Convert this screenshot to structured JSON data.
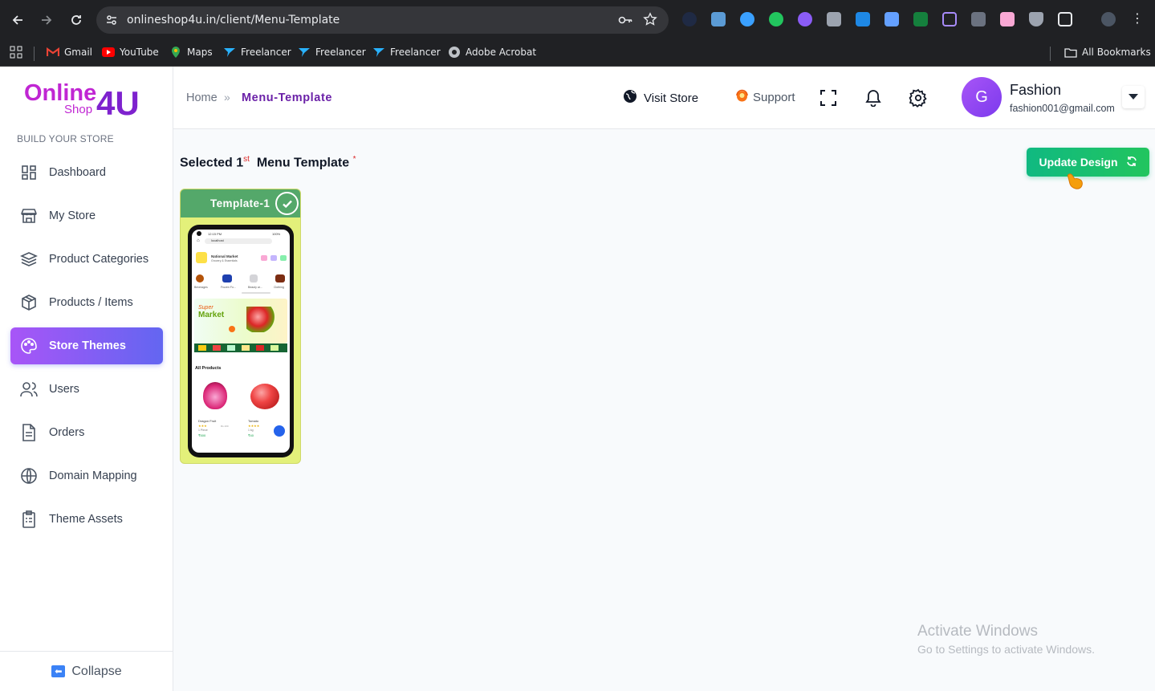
{
  "browser": {
    "url": "onlineshop4u.in/client/Menu-Template",
    "bookmarks": [
      {
        "label": "Gmail",
        "icon": "gmail-icon"
      },
      {
        "label": "YouTube",
        "icon": "youtube-icon"
      },
      {
        "label": "Maps",
        "icon": "maps-icon"
      },
      {
        "label": "Freelancer",
        "icon": "freelancer-icon"
      },
      {
        "label": "Freelancer",
        "icon": "freelancer-icon"
      },
      {
        "label": "Freelancer",
        "icon": "freelancer-icon"
      },
      {
        "label": "Adobe Acrobat",
        "icon": "acrobat-icon"
      }
    ],
    "all_bookmarks": "All Bookmarks"
  },
  "sidebar": {
    "section_label": "BUILD YOUR STORE",
    "logo": {
      "line1": "Online",
      "line2": "Shop",
      "mark": "4U"
    },
    "items": [
      {
        "label": "Dashboard",
        "icon": "dashboard-icon"
      },
      {
        "label": "My Store",
        "icon": "store-icon"
      },
      {
        "label": "Product Categories",
        "icon": "layers-icon"
      },
      {
        "label": "Products / Items",
        "icon": "box-icon"
      },
      {
        "label": "Store Themes",
        "icon": "palette-icon",
        "active": true
      },
      {
        "label": "Users",
        "icon": "users-icon"
      },
      {
        "label": "Orders",
        "icon": "document-icon"
      },
      {
        "label": "Domain Mapping",
        "icon": "globe-icon"
      },
      {
        "label": "Theme Assets",
        "icon": "clipboard-icon"
      }
    ],
    "collapse_label": "Collapse"
  },
  "header": {
    "breadcrumb_home": "Home",
    "breadcrumb_sep": "»",
    "breadcrumb_current": "Menu-Template",
    "visit_store": "Visit Store",
    "support": "Support",
    "user": {
      "initial": "G",
      "name": "Fashion",
      "email": "fashion001@gmail.com"
    }
  },
  "main": {
    "heading_prefix": "Selected 1",
    "heading_ordinal": "st",
    "heading_suffix": "Menu Template",
    "required_mark": "*",
    "update_button": "Update Design",
    "template": {
      "label": "Template-1",
      "preview": {
        "time": "12:15 PM",
        "battery": "100%",
        "search": "localhost",
        "brand": "National Market",
        "tagline": "Grocery & Essentials",
        "categories": [
          "Beverages",
          "Frozen Fo...",
          "Beauty ar...",
          "Clothing"
        ],
        "banner_script": "Super",
        "banner_title": "Market",
        "section_title": "All Products",
        "products": [
          {
            "name": "Dragon Fruit",
            "unit": "1 Piece",
            "price": "₹500",
            "mrp": "Rs.100"
          },
          {
            "name": "Tomato",
            "unit": "1 kg",
            "price": "₹40"
          }
        ]
      }
    }
  },
  "watermark": {
    "line1": "Activate Windows",
    "line2": "Go to Settings to activate Windows."
  },
  "colors": {
    "accent_purple": "#6b21a8",
    "active_gradient_start": "#a855f7",
    "active_gradient_end": "#6366f1",
    "update_green": "#10b981",
    "template_header": "#54a86a",
    "template_bg": "#e3f07a"
  }
}
